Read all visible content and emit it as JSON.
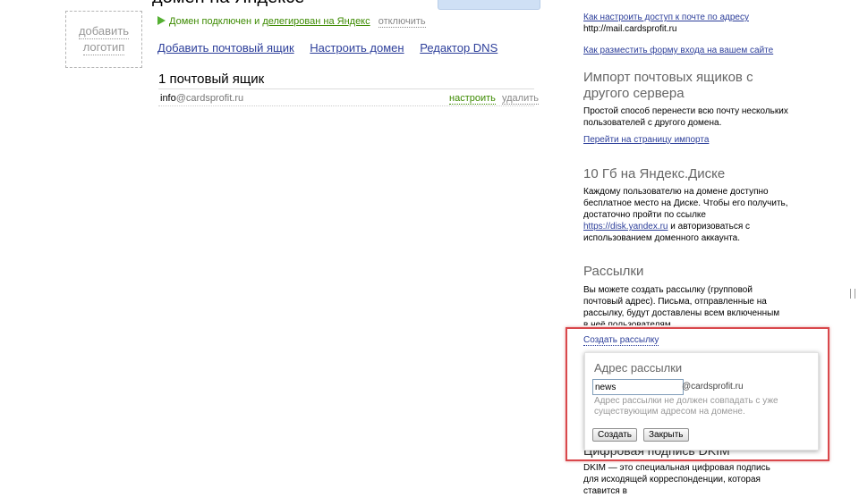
{
  "header": {
    "clipped_title": "домен на Яндексе",
    "logo_placeholder": [
      "добавить",
      "логотип"
    ]
  },
  "domain_status": {
    "prefix": "Домен подключен и",
    "delegated_link": "делегирован на Яндекс",
    "disconnect": "отключить"
  },
  "main_links": [
    "Добавить почтовый ящик",
    "Настроить домен",
    "Редактор DNS"
  ],
  "mailboxes": {
    "heading": "1 почтовый ящик",
    "items": [
      {
        "login": "info",
        "domain": "@cardsprofit.ru",
        "configure": "настроить",
        "delete": "удалить"
      }
    ]
  },
  "sidebar": {
    "access_link": "Как настроить доступ к почте по адресу",
    "mail_url": "http://mail.cardsprofit.ru",
    "form_link": "Как разместить форму входа на вашем сайте",
    "import_heading": "Импорт почтовых ящиков с другого сервера",
    "import_text": "Простой способ перенести всю почту нескольких пользователей с другого домена.",
    "import_link": "Перейти на страницу импорта",
    "disk_heading": "10 Гб на Яндекс.Диске",
    "disk_text": "Каждому пользователю на домене доступно бесплатное место на Диске. Чтобы его получить, достаточно пройти по ссылке",
    "disk_url": "https://disk.yandex.ru",
    "disk_text2": "и авторизоваться с использованием доменного аккаунта.",
    "lists_heading": "Рассылки",
    "lists_text": "Вы можете создать рассылку (групповой почтовый адрес). Письма, отправленные на рассылку, будут доставлены всем включенным в неё пользователям.",
    "create_list_link": "Создать рассылку",
    "dkim_heading": "Цифровая подпись DKIM",
    "dkim_text": "DKIM — это специальная цифровая подпись для исходящей корреспонденции, которая ставится в"
  },
  "popup": {
    "title": "Адрес рассылки",
    "input_value": "news",
    "domain_suffix": "@cardsprofit.ru",
    "note": "Адрес рассылки не должен совпадать с уже существующим адресом на домене.",
    "create_button": "Создать",
    "close_button": "Закрыть"
  }
}
